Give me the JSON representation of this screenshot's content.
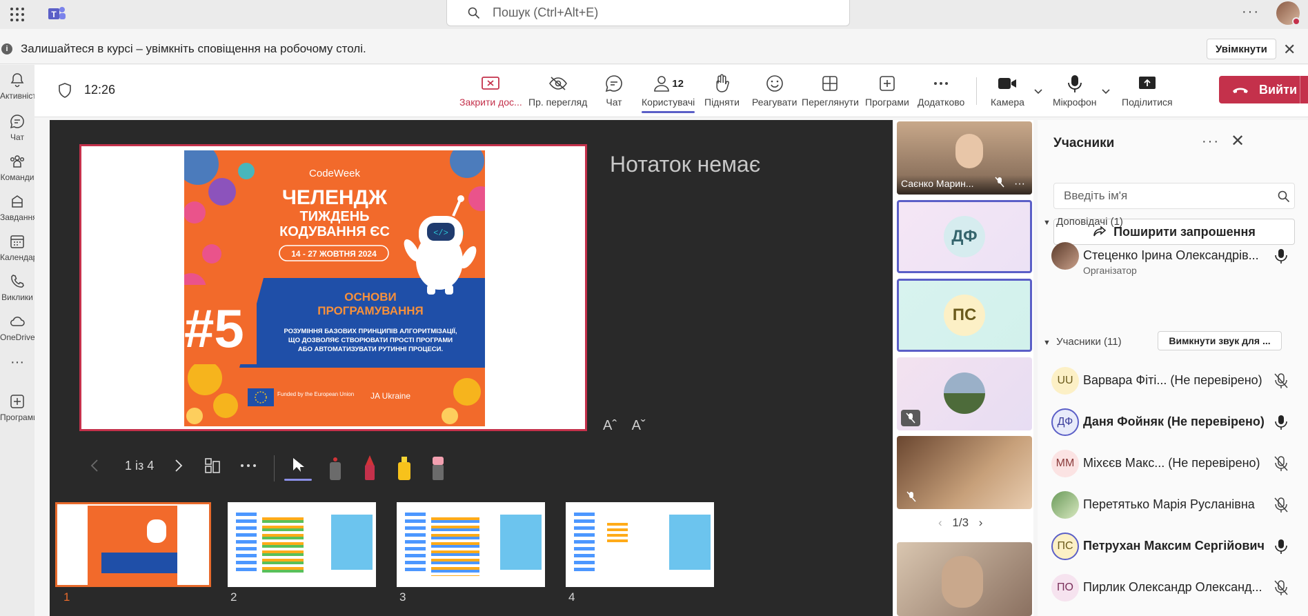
{
  "topbar": {
    "search_placeholder": "Пошук (Ctrl+Alt+E)",
    "more_label": "···"
  },
  "notification": {
    "text": "Залишайтеся в курсі – увімкніть сповіщення на робочому столі.",
    "enable_label": "Увімкнути"
  },
  "rail": {
    "items": [
      {
        "label": "Активність",
        "icon": "bell-icon"
      },
      {
        "label": "Чат",
        "icon": "chat-icon"
      },
      {
        "label": "Команди",
        "icon": "teams-icon"
      },
      {
        "label": "Завдання",
        "icon": "assignments-icon"
      },
      {
        "label": "Календар",
        "icon": "calendar-icon"
      },
      {
        "label": "Виклики",
        "icon": "phone-icon"
      },
      {
        "label": "OneDrive",
        "icon": "cloud-icon"
      },
      {
        "label": "···",
        "icon": "more-icon"
      },
      {
        "label": "Програми",
        "icon": "apps-icon"
      }
    ]
  },
  "toolbar": {
    "time": "12:26",
    "stop_sharing_label": "Закрити дос...",
    "preview_label": "Пр. перегляд",
    "chat_label": "Чат",
    "people_label": "Користувачі",
    "people_count": "12",
    "raise_label": "Підняти",
    "react_label": "Реагувати",
    "view_label": "Переглянути",
    "apps_label": "Програми",
    "more_label": "Додатково",
    "camera_label": "Камера",
    "mic_label": "Мікрофон",
    "share_label": "Поділитися",
    "leave_label": "Вийти"
  },
  "stage": {
    "notes_empty": "Нотаток немає",
    "font_increase": "Aˆ",
    "font_decrease": "Aˇ",
    "page_indicator": "1 із 4",
    "slide": {
      "brand": "CodeWeek",
      "title_1": "ЧЕЛЕНДЖ",
      "title_2": "ТИЖДЕНЬ",
      "title_3": "КОДУВАННЯ ЄС",
      "dates": "14 - 27 ЖОВТНЯ 2024",
      "number": "#5",
      "topic_1": "ОСНОВИ",
      "topic_2": "ПРОГРАМУВАННЯ",
      "desc_1": "РОЗУМІННЯ БАЗОВИХ ПРИНЦИПІВ АЛГОРИТМІЗАЦІЇ,",
      "desc_2": "ЩО ДОЗВОЛЯЄ СТВОРЮВАТИ ПРОСТІ ПРОГРАМИ",
      "desc_3": "АБО АВТОМАТИЗУВАТИ РУТИННІ ПРОЦЕСИ.",
      "funded": "Funded by the European Union",
      "ja": "JA Ukraine",
      "code_tag": "</>"
    },
    "thumbnails": [
      "1",
      "2",
      "3",
      "4"
    ]
  },
  "videos": {
    "tile1_name": "Саєнко Марин...",
    "tile2_initials": "ДФ",
    "tile3_initials": "ПС",
    "pager": "1/3"
  },
  "panel": {
    "title": "Учасники",
    "search_placeholder": "Введіть ім'я",
    "invite_label": "Поширити запрошення",
    "presenters_label": "Доповідачі (1)",
    "attendees_label": "Учасники (11)",
    "mute_all_label": "Вимкнути звук для ...",
    "presenters": [
      {
        "name": "Стеценко Ірина Олександрів...",
        "role": "Організатор",
        "initials": "",
        "mic": "on"
      }
    ],
    "attendees": [
      {
        "initials": "UU",
        "name": "Варвара Фіті...  (Не перевірено)",
        "bold": false,
        "mic": "off"
      },
      {
        "initials": "ДФ",
        "name": "Даня Фойняк (Не перевірено)",
        "bold": true,
        "mic": "on"
      },
      {
        "initials": "ММ",
        "name": "Міхєєв Макс...  (Не перевірено)",
        "bold": false,
        "mic": "off"
      },
      {
        "initials": "",
        "name": "Перетятько Марія Русланівна",
        "bold": false,
        "mic": "off"
      },
      {
        "initials": "ПС",
        "name": "Петрухан Максим Сергійович",
        "bold": true,
        "mic": "on"
      },
      {
        "initials": "ПО",
        "name": "Пирлик Олександр Олександ...",
        "bold": false,
        "mic": "off"
      }
    ]
  },
  "colors": {
    "accent": "#5b5fc7",
    "leave_red": "#c4314b",
    "slide_orange": "#f26a2b",
    "slide_blue": "#1f4fa8"
  }
}
